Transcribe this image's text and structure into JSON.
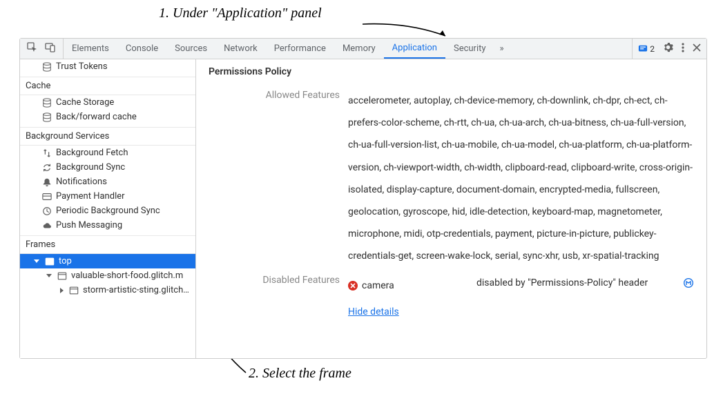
{
  "annotations": {
    "note1": "1. Under \"Application\" panel",
    "note2": "2. Select the frame"
  },
  "tabs": {
    "elements": "Elements",
    "console": "Console",
    "sources": "Sources",
    "network": "Network",
    "performance": "Performance",
    "memory": "Memory",
    "application": "Application",
    "security": "Security",
    "overflow": "»"
  },
  "issues_count": "2",
  "sidebar": {
    "trust_tokens": "Trust Tokens",
    "groups": {
      "cache": "Cache",
      "background_services": "Background Services",
      "frames": "Frames"
    },
    "items": {
      "cache_storage": "Cache Storage",
      "back_forward_cache": "Back/forward cache",
      "background_fetch": "Background Fetch",
      "background_sync": "Background Sync",
      "notifications": "Notifications",
      "payment_handler": "Payment Handler",
      "periodic_background_sync": "Periodic Background Sync",
      "push_messaging": "Push Messaging"
    },
    "frames": {
      "top": "top",
      "child1": "valuable-short-food.glitch.m",
      "child2": "storm-artistic-sting.glitch.m"
    }
  },
  "content": {
    "title": "Permissions Policy",
    "allowed_label": "Allowed Features",
    "allowed_value": "accelerometer, autoplay, ch-device-memory, ch-downlink, ch-dpr, ch-ect, ch-prefers-color-scheme, ch-rtt, ch-ua, ch-ua-arch, ch-ua-bitness, ch-ua-full-version, ch-ua-full-version-list, ch-ua-mobile, ch-ua-model, ch-ua-platform, ch-ua-platform-version, ch-viewport-width, ch-width, clipboard-read, clipboard-write, cross-origin-isolated, display-capture, document-domain, encrypted-media, fullscreen, geolocation, gyroscope, hid, idle-detection, keyboard-map, magnetometer, microphone, midi, otp-credentials, payment, picture-in-picture, publickey-credentials-get, screen-wake-lock, serial, sync-xhr, usb, xr-spatial-tracking",
    "disabled_label": "Disabled Features",
    "disabled_feature_name": "camera",
    "disabled_reason": "disabled by \"Permissions-Policy\" header",
    "hide_details": "Hide details"
  }
}
